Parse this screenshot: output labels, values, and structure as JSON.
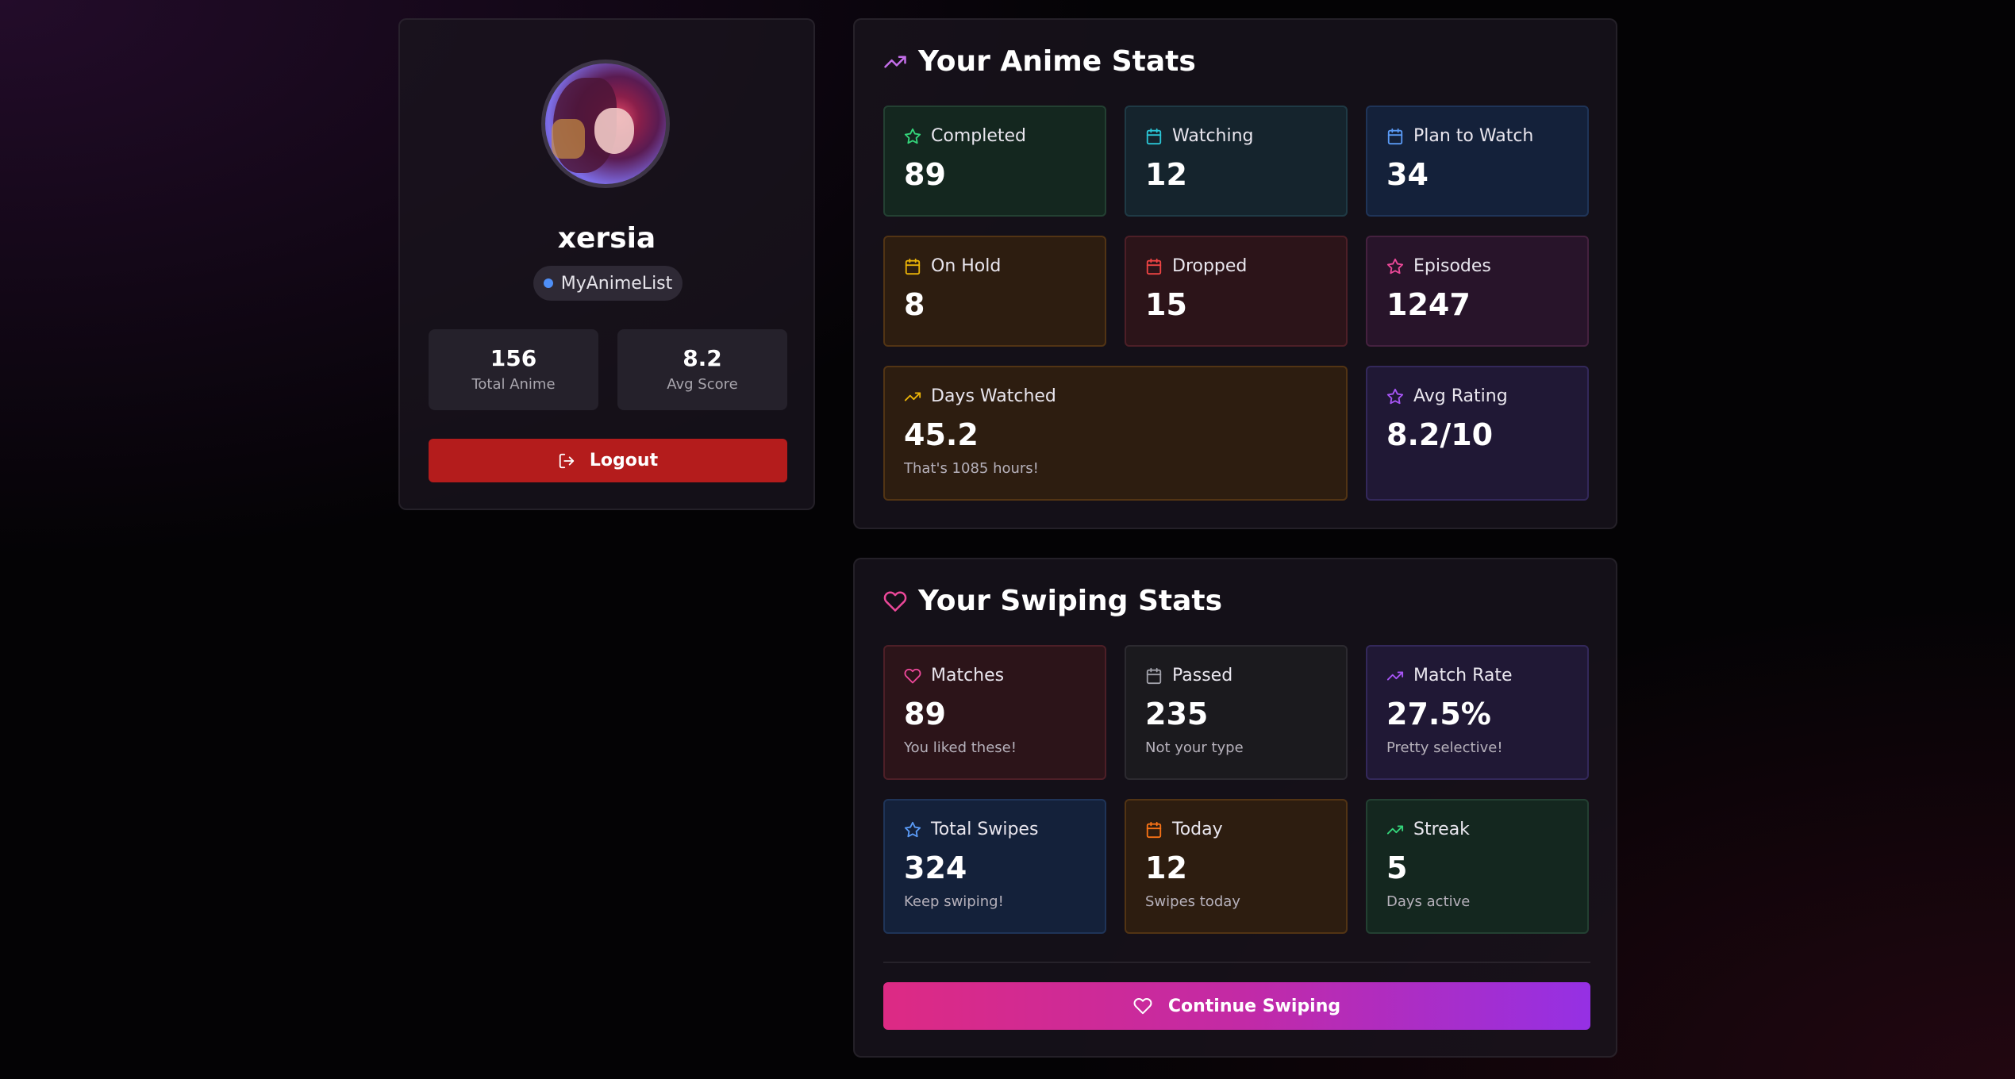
{
  "profile": {
    "username": "xersia",
    "source": "MyAnimeList",
    "stats": [
      {
        "value": "156",
        "label": "Total Anime"
      },
      {
        "value": "8.2",
        "label": "Avg Score"
      }
    ],
    "logout_label": "Logout"
  },
  "anime_stats": {
    "title": "Your Anime Stats",
    "tiles": [
      {
        "label": "Completed",
        "value": "89"
      },
      {
        "label": "Watching",
        "value": "12"
      },
      {
        "label": "Plan to Watch",
        "value": "34"
      },
      {
        "label": "On Hold",
        "value": "8"
      },
      {
        "label": "Dropped",
        "value": "15"
      },
      {
        "label": "Episodes",
        "value": "1247"
      },
      {
        "label": "Days Watched",
        "value": "45.2",
        "sub": "That's 1085 hours!"
      },
      {
        "label": "Avg Rating",
        "value": "8.2/10"
      }
    ]
  },
  "swiping_stats": {
    "title": "Your Swiping Stats",
    "tiles": [
      {
        "label": "Matches",
        "value": "89",
        "sub": "You liked these!"
      },
      {
        "label": "Passed",
        "value": "235",
        "sub": "Not your type"
      },
      {
        "label": "Match Rate",
        "value": "27.5%",
        "sub": "Pretty selective!"
      },
      {
        "label": "Total Swipes",
        "value": "324",
        "sub": "Keep swiping!"
      },
      {
        "label": "Today",
        "value": "12",
        "sub": "Swipes today"
      },
      {
        "label": "Streak",
        "value": "5",
        "sub": "Days active"
      }
    ],
    "cta_label": "Continue Swiping"
  },
  "colors": {
    "accent_pink": "#dd2a84",
    "accent_purple": "#9530e4",
    "logout_red": "#b41c1c",
    "badge_dot_blue": "#4f8ff7"
  }
}
